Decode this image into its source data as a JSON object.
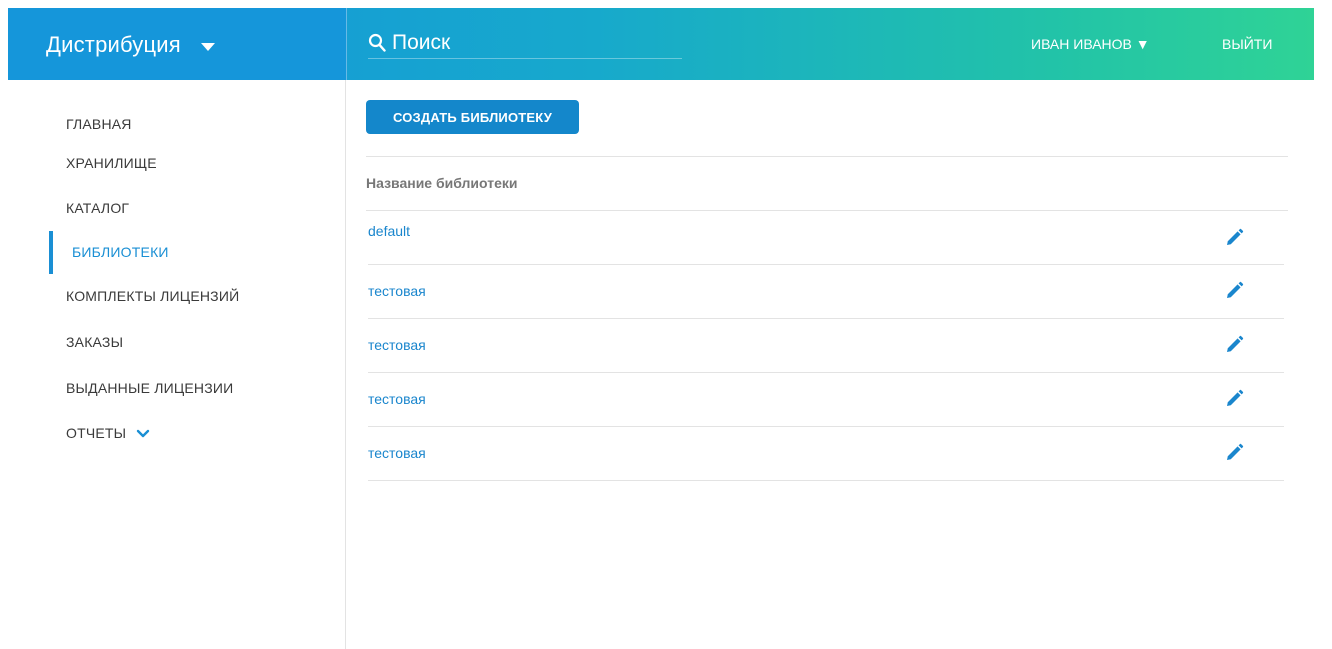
{
  "header": {
    "brand": "Дистрибуция",
    "search_placeholder": "Поиск",
    "user_name": "ИВАН ИВАНОВ ▼",
    "logout": "ВЫЙТИ"
  },
  "sidebar": {
    "items": [
      {
        "label": "ГЛАВНАЯ"
      },
      {
        "label": "ХРАНИЛИЩЕ"
      },
      {
        "label": "КАТАЛОГ"
      },
      {
        "label": "БИБЛИОТЕКИ",
        "active": true
      },
      {
        "label": "КОМПЛЕКТЫ ЛИЦЕНЗИЙ"
      },
      {
        "label": "ЗАКАЗЫ"
      },
      {
        "label": "ВЫДАННЫЕ ЛИЦЕНЗИИ"
      },
      {
        "label": "ОТЧЕТЫ"
      }
    ]
  },
  "main": {
    "create_button": "СОЗДАТЬ БИБЛИОТЕКУ",
    "column_header": "Название библиотеки",
    "rows": [
      {
        "name": "default"
      },
      {
        "name": "тестовая"
      },
      {
        "name": "тестовая"
      },
      {
        "name": "тестовая"
      },
      {
        "name": "тестовая"
      }
    ]
  },
  "colors": {
    "accent": "#1a8fd4",
    "header_start": "#1594dc",
    "header_end": "#2fd396",
    "button": "#1487cb"
  },
  "icons": [
    "chevron-down-icon",
    "search-icon",
    "edit-icon"
  ]
}
